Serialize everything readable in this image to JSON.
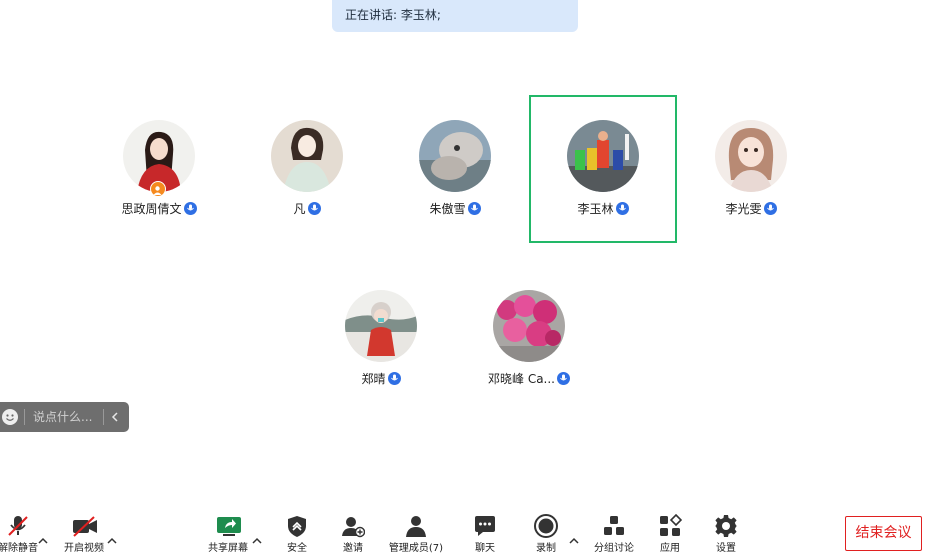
{
  "speaker_banner": {
    "text": "正在讲话: 李玉林;"
  },
  "participants": [
    {
      "name": "思政周倩文",
      "host": true
    },
    {
      "name": "凡",
      "host": false
    },
    {
      "name": "朱傲雪",
      "host": false
    },
    {
      "name": "李玉林",
      "host": false,
      "active_speaker": true
    },
    {
      "name": "李光雯",
      "host": false
    },
    {
      "name": "郑晴",
      "host": false
    },
    {
      "name": "邓晓峰 Ca...",
      "host": false
    }
  ],
  "chat": {
    "placeholder": "说点什么..."
  },
  "toolbar": {
    "unmute": "解除静音",
    "start_video": "开启视频",
    "share_screen": "共享屏幕",
    "security": "安全",
    "invite": "邀请",
    "manage_members": "管理成员(7)",
    "chat": "聊天",
    "record": "录制",
    "breakout": "分组讨论",
    "apps": "应用",
    "settings": "设置",
    "end_meeting": "结束会议"
  },
  "colors": {
    "active_border": "#22b868",
    "mic_badge": "#2f6fe4",
    "end_meeting": "#e02020",
    "banner_bg": "#d9e8fb"
  }
}
